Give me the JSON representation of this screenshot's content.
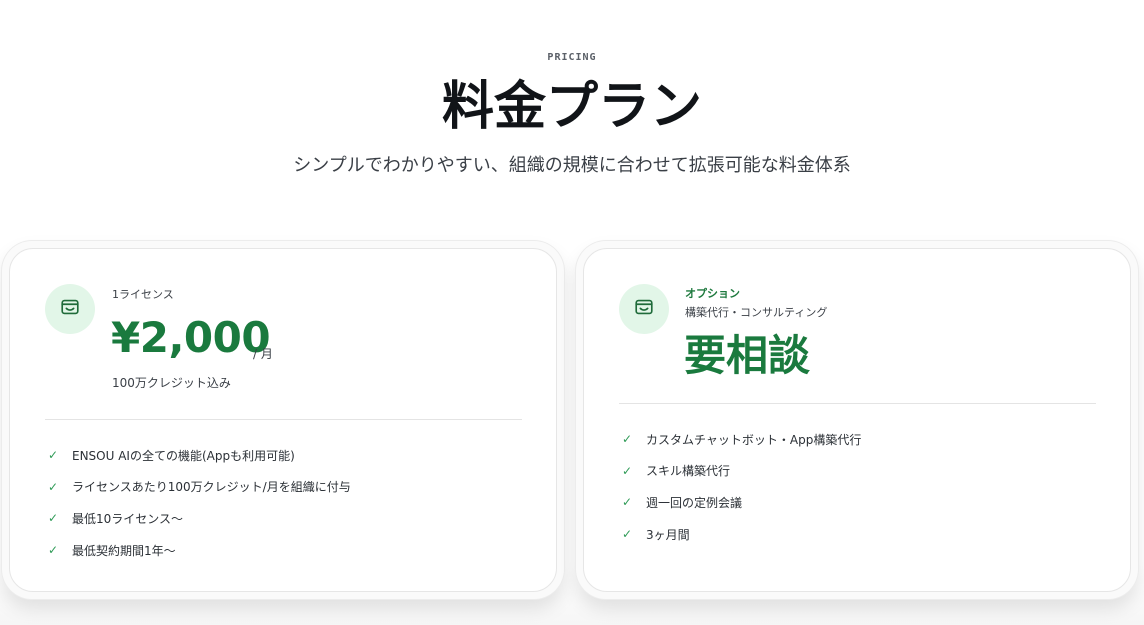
{
  "header": {
    "eyebrow": "PRICING",
    "title": "料金プラン",
    "subtitle": "シンプルでわかりやすい、組織の規模に合わせて拡張可能な料金体系"
  },
  "plans": [
    {
      "icon": "wallet-icon",
      "label": "1ライセンス",
      "price": "¥2,000",
      "price_unit": "/ 月",
      "note": "100万クレジット込み",
      "features": [
        "ENSOU AIの全ての機能(Appも利用可能)",
        "ライセンスあたり100万クレジット/月を組織に付与",
        "最低10ライセンス〜",
        "最低契約期間1年〜"
      ]
    },
    {
      "icon": "wallet-icon",
      "tag": "オプション",
      "label": "構築代行・コンサルティング",
      "price": "要相談",
      "features": [
        "カスタムチャットボット・App構築代行",
        "スキル構築代行",
        "週一回の定例会議",
        "3ヶ月間"
      ]
    }
  ],
  "colors": {
    "accent": "#1a7a3e",
    "icon_bg": "#e2f6e8",
    "check": "#2f9b57"
  }
}
